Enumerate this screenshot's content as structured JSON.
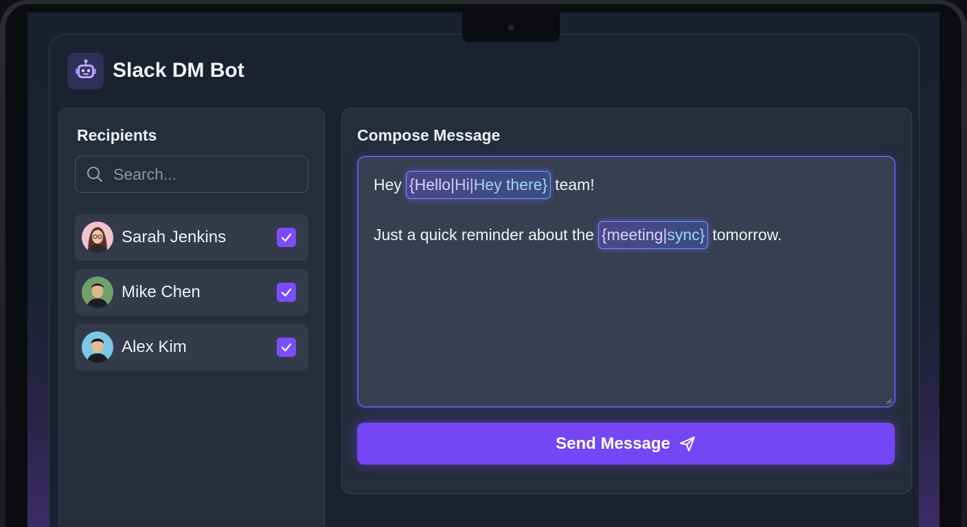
{
  "app": {
    "title": "Slack DM Bot",
    "logo_icon": "robot-icon"
  },
  "recipients": {
    "title": "Recipients",
    "search_placeholder": "Search...",
    "items": [
      {
        "name": "Sarah Jenkins",
        "checked": true
      },
      {
        "name": "Mike Chen",
        "checked": true
      },
      {
        "name": "Alex Kim",
        "checked": true
      }
    ]
  },
  "compose": {
    "title": "Compose Message",
    "line1": {
      "before": "Hey",
      "token": [
        "{Hello|",
        "Hi|",
        "Hey there}"
      ],
      "after": "team!"
    },
    "line2": {
      "before": "Just a quick reminder about the",
      "token": [
        "{meeting|",
        "sync}"
      ],
      "after": "tomorrow."
    },
    "send_label": "Send Message",
    "send_icon": "paper-plane-icon"
  },
  "colors": {
    "accent": "#7446f4",
    "panel": "#252c3a",
    "background": "#1b2130"
  }
}
